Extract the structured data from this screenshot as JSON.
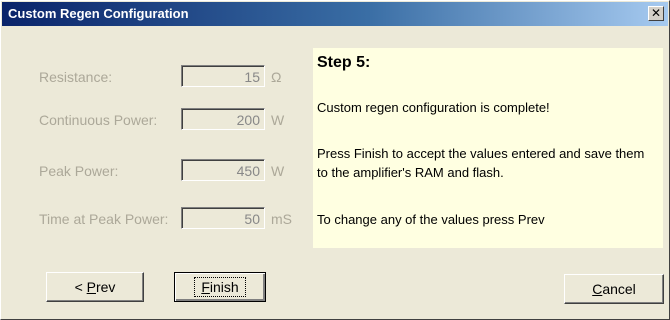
{
  "window": {
    "title": "Custom Regen Configuration",
    "close_glyph": "✕"
  },
  "fields": [
    {
      "label": "Resistance:",
      "value": "15",
      "unit": "Ω"
    },
    {
      "label": "Continuous Power:",
      "value": "200",
      "unit": "W"
    },
    {
      "label": "Peak Power:",
      "value": "450",
      "unit": "W"
    },
    {
      "label": "Time at Peak Power:",
      "value": "50",
      "unit": "mS"
    }
  ],
  "info": {
    "step": "Step 5:",
    "line1": "Custom regen configuration is complete!",
    "line2": "Press Finish to accept the values entered and save them to the amplifier's RAM and flash.",
    "line3": "To change any of the values press Prev"
  },
  "buttons": {
    "prev_prefix": "< ",
    "prev_accel": "P",
    "prev_rest": "rev",
    "finish_accel": "F",
    "finish_rest": "inish",
    "cancel_accel": "C",
    "cancel_rest": "ancel"
  },
  "colors": {
    "info_background": "#ffffe1",
    "disabled_text": "#aca899",
    "titlebar": "#0a246a"
  }
}
